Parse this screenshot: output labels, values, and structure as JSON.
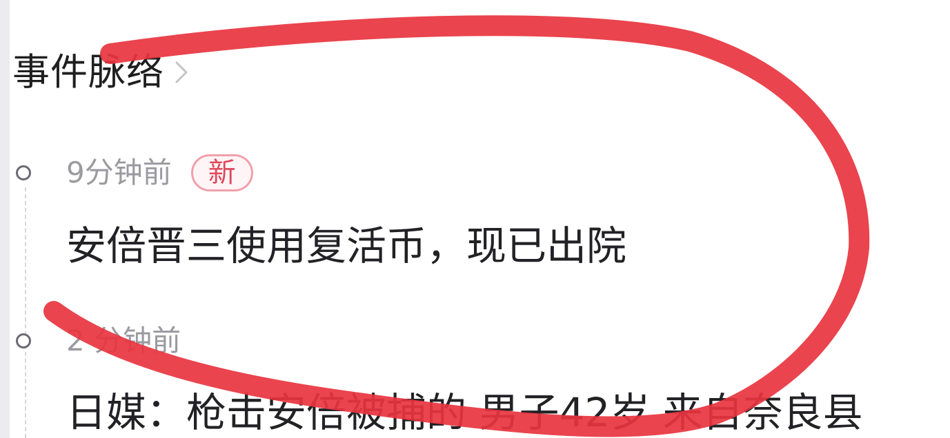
{
  "section": {
    "title": "事件脉络",
    "chevron_icon": "chevron-right-icon"
  },
  "timeline": {
    "items": [
      {
        "time": "9分钟前",
        "badge": "新",
        "headline": "安倍晋三使用复活币，现已出院"
      },
      {
        "time": "2 分钟前",
        "headline": "日媒：枪击安倍被捕的 男子42岁 来自奈良县"
      }
    ]
  },
  "colors": {
    "annotation_stroke": "#e8343f",
    "badge_text": "#e04a5e",
    "badge_border": "#f0a0aa",
    "time_text": "#9a9aa0",
    "headline_text": "#222226"
  }
}
